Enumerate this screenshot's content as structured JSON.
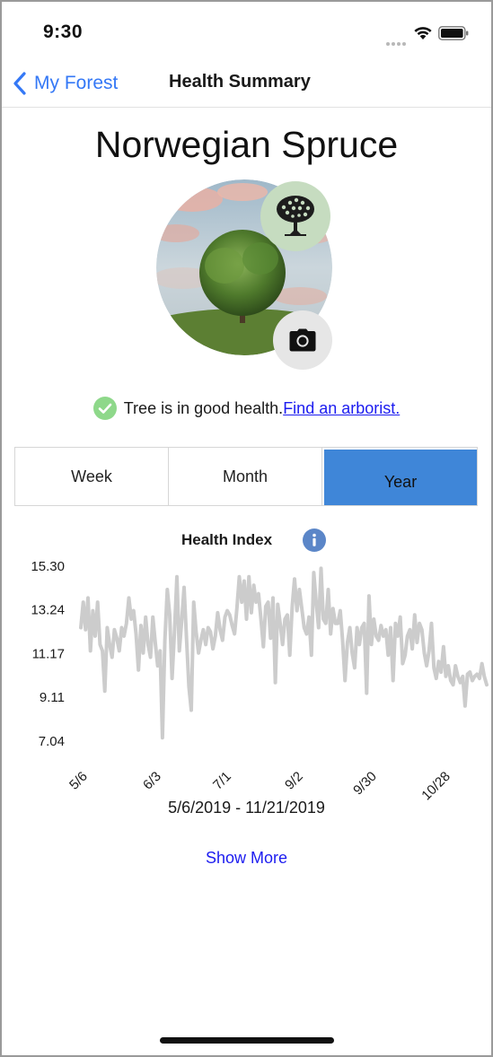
{
  "status_bar": {
    "time": "9:30"
  },
  "nav": {
    "back_label": "My Forest",
    "title": "Health Summary"
  },
  "tree": {
    "name": "Norwegian Spruce"
  },
  "health": {
    "status_text": "Tree is in good health.",
    "link_text": "Find an arborist."
  },
  "segments": [
    {
      "label": "Week",
      "active": false
    },
    {
      "label": "Month",
      "active": false
    },
    {
      "label": "Year",
      "active": true
    }
  ],
  "colors": {
    "accent_blue": "#3478f6",
    "segment_active": "#3f86d8",
    "link_blue": "#1c1cf0",
    "line_gray": "#cccccc",
    "check_green": "#8ed88a",
    "badge_green": "#c6dcc0",
    "info_blue": "#5b86c8"
  },
  "icons": [
    "chevron-left-icon",
    "wifi-icon",
    "battery-icon",
    "tree-icon",
    "camera-icon",
    "check-circle-icon",
    "info-icon"
  ],
  "chart": {
    "title": "Health Index",
    "date_range": "5/6/2019 - 11/21/2019",
    "show_more": "Show More"
  },
  "chart_data": {
    "type": "line",
    "title": "Health Index",
    "xlabel": "",
    "ylabel": "",
    "ylim": [
      7.04,
      15.3
    ],
    "y_ticks": [
      "15.30",
      "13.24",
      "11.17",
      "9.11",
      "7.04"
    ],
    "x_tick_labels": [
      "5/6",
      "6/3",
      "7/1",
      "9/2",
      "9/30",
      "10/28"
    ],
    "grid": false,
    "legend": "none",
    "series": [
      {
        "values": [
          12.4,
          13.6,
          12.3,
          13.8,
          11.3,
          13.2,
          12.0,
          13.6,
          11.6,
          11.3,
          9.4,
          12.4,
          11.6,
          11.0,
          12.3,
          11.9,
          11.3,
          12.4,
          12.0,
          12.6,
          13.8,
          12.8,
          13.2,
          12.1,
          10.4,
          12.5,
          11.2,
          12.9,
          11.6,
          11.0,
          12.9,
          11.7,
          10.6,
          11.3,
          7.2,
          11.8,
          14.2,
          13.0,
          10.0,
          12.2,
          14.8,
          11.3,
          12.7,
          14.3,
          11.9,
          9.6,
          8.5,
          13.6,
          12.2,
          11.2,
          11.8,
          12.3,
          11.6,
          12.4,
          12.2,
          11.4,
          12.0,
          13.1,
          12.3,
          11.8,
          12.9,
          13.2,
          13.0,
          12.5,
          12.1,
          13.3,
          14.8,
          13.6,
          14.6,
          12.8,
          14.8,
          13.1,
          14.4,
          13.6,
          14.0,
          12.8,
          11.5,
          13.4,
          13.6,
          11.9,
          13.8,
          9.8,
          13.5,
          12.6,
          11.6,
          12.8,
          13.0,
          11.1,
          13.4,
          14.7,
          13.2,
          14.2,
          13.3,
          12.4,
          12.1,
          12.9,
          11.1,
          15.0,
          13.6,
          12.4,
          15.2,
          12.8,
          12.6,
          14.2,
          12.1,
          13.3,
          12.6,
          12.6,
          13.2,
          11.8,
          9.9,
          11.7,
          12.4,
          11.2,
          10.5,
          12.4,
          11.6,
          12.4,
          12.6,
          9.3,
          13.9,
          11.6,
          12.8,
          12.0,
          11.8,
          12.5,
          12.0,
          12.3,
          11.1,
          12.4,
          9.9,
          12.6,
          12.0,
          12.9,
          10.7,
          11.1,
          12.0,
          12.3,
          11.4,
          13.0,
          11.7,
          12.6,
          12.3,
          11.2,
          10.6,
          11.3,
          12.6,
          10.5,
          10.0,
          10.8,
          10.3,
          11.5,
          10.1,
          10.6,
          9.9,
          9.7,
          10.6,
          10.1,
          9.8,
          10.1,
          8.7,
          10.2,
          10.3,
          9.9,
          10.1,
          10.2,
          10.0,
          10.7,
          10.1,
          9.7
        ]
      }
    ]
  }
}
